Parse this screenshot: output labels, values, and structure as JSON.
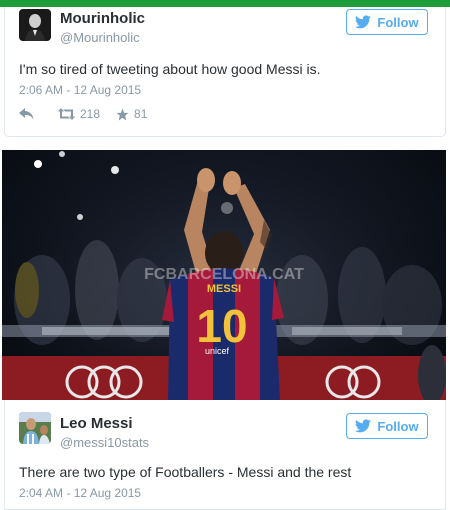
{
  "tweet1": {
    "name": "Mourinholic",
    "handle": "@Mourinholic",
    "follow_label": "Follow",
    "text": "I'm so tired of tweeting about how good Messi is.",
    "timestamp": "2:06 AM - 12 Aug 2015",
    "retweets": "218",
    "favorites": "81"
  },
  "photo": {
    "watermark": "FCBARCELONA.CAT",
    "shirt_name": "MESSI",
    "shirt_number": "10",
    "sponsor": "unicef"
  },
  "tweet2": {
    "name": "Leo Messi",
    "handle": "@messi10stats",
    "follow_label": "Follow",
    "text": "There are two type of Footballers - Messi and the rest",
    "timestamp": "2:04 AM - 12 Aug 2015"
  },
  "colors": {
    "accent": "#55acee",
    "top_bar": "#1f9d3a",
    "jersey_blue": "#1b2a6b",
    "jersey_red": "#a5193a",
    "number_gold": "#f2c23a"
  }
}
